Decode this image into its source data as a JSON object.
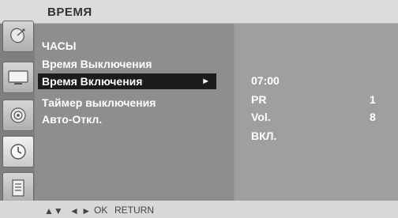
{
  "header": {
    "title": "ВРЕМЯ"
  },
  "menu": {
    "items": [
      {
        "label": "ЧАСЫ"
      },
      {
        "label": "Время Выключения"
      },
      {
        "label": "Время Включения"
      },
      {
        "label": "Таймер выключения"
      },
      {
        "label": "Авто-Откл."
      }
    ],
    "selected_arrow": "►"
  },
  "values": {
    "time": "07:00",
    "pr_label": "PR",
    "pr_value": "1",
    "vol_label": "Vol.",
    "vol_value": "8",
    "state": "ВКЛ."
  },
  "sidebar": {
    "icons": [
      "satellite-dish-icon",
      "tv-screen-icon",
      "speaker-icon",
      "clock-icon",
      "document-lines-icon"
    ],
    "active_icon_index": 3
  },
  "footer": {
    "nav_updown": "▲▼",
    "nav_leftright": "◄ ►",
    "ok_label": "OK",
    "return_label": "RETURN"
  }
}
